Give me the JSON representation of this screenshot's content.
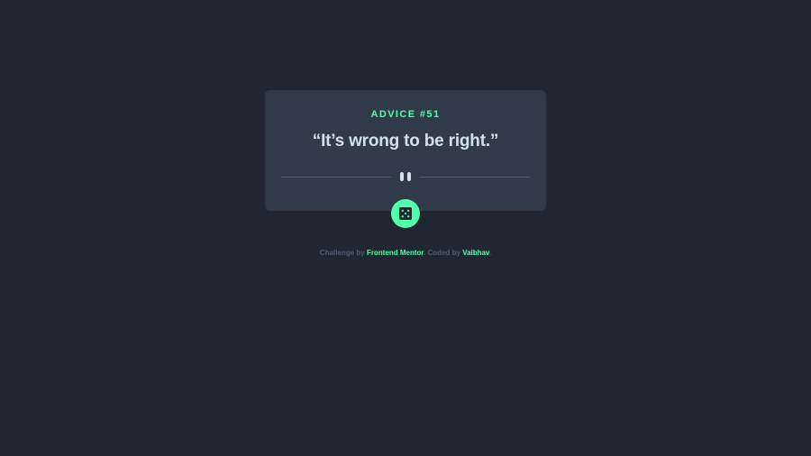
{
  "card": {
    "advice_label": "ADVICE #51",
    "advice_text": "“It’s wrong to be right.”"
  },
  "dice_button": {
    "icon": "dice-icon"
  },
  "footer": {
    "challenge_prefix": "Challenge by",
    "challenge_link": "Frontend Mentor",
    "coded_prefix": ". Coded by",
    "coded_link": "Vaibhav",
    "suffix": "."
  },
  "colors": {
    "background": "#202733",
    "card": "#313a48",
    "accent": "#53ffaa",
    "text": "#cee3e9",
    "muted": "#4f5d74"
  }
}
